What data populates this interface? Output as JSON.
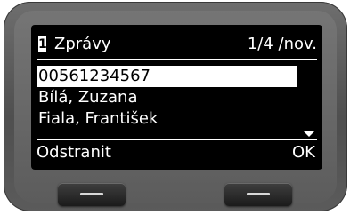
{
  "screen": {
    "line_number": "1",
    "title": "Zprávy",
    "counter": "1/4 /nov.",
    "items": [
      {
        "label": "00561234567",
        "selected": true
      },
      {
        "label": "Bílá, Zuzana",
        "selected": false
      },
      {
        "label": "Fiala, František",
        "selected": false
      }
    ],
    "softkeys": {
      "left": "Odstranit",
      "right": "OK"
    }
  },
  "colors": {
    "screen_bg": "#000000",
    "screen_text": "#ffffff",
    "highlight_bg": "#ffffff",
    "device_body": "#5c5c5c"
  },
  "icons": {
    "scroll": "triangle-down-icon",
    "softkey_bar": "minus-icon"
  }
}
